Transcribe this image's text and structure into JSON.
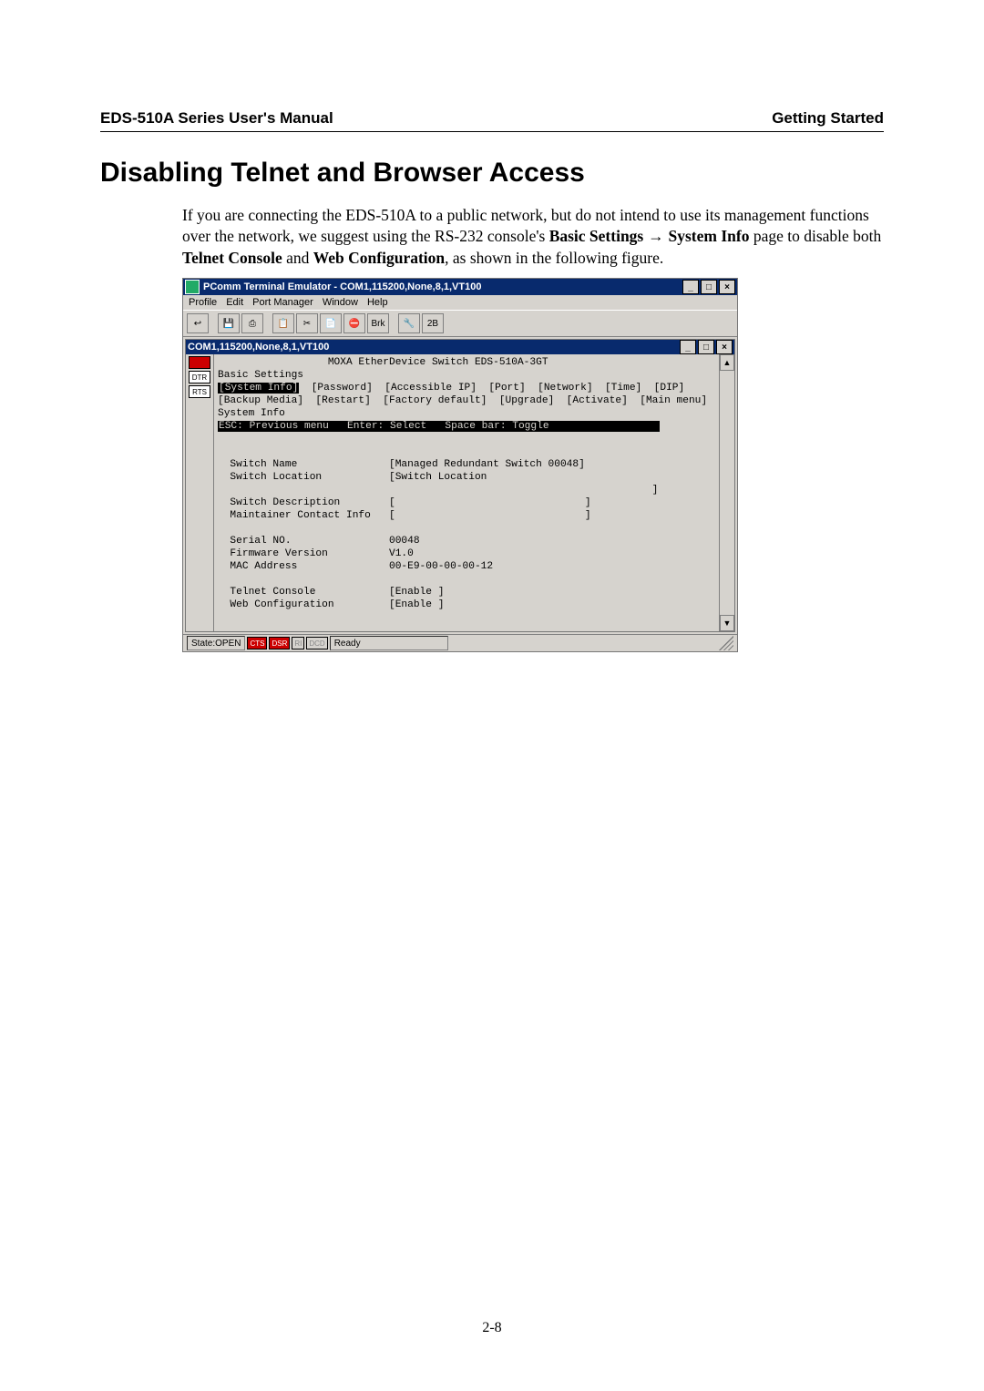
{
  "header": {
    "left": "EDS-510A Series User's Manual",
    "right": "Getting Started"
  },
  "heading": "Disabling Telnet and Browser Access",
  "paragraph": {
    "t1": "If you are connecting the EDS-510A to a public network, but do not intend to use its management functions over the network, we suggest using the RS-232 console's ",
    "b1": "Basic Settings",
    "arrow": " → ",
    "b2": "System Info",
    "t2": " page to disable both ",
    "b3": "Telnet Console",
    "t3": " and ",
    "b4": "Web Configuration",
    "t4": ", as shown in the following figure."
  },
  "screenshot": {
    "outer_title": "PComm Terminal Emulator - COM1,115200,None,8,1,VT100",
    "menus": [
      "Profile",
      "Edit",
      "Port Manager",
      "Window",
      "Help"
    ],
    "menu_underline_idx": [
      0,
      0,
      0,
      0,
      0
    ],
    "toolbar_labels": [
      "↩",
      "💾",
      "⎙",
      "📋",
      "✂",
      "📄",
      "⛔",
      "Brk",
      "",
      "🔧",
      "2B"
    ],
    "inner_title": "COM1,115200,None,8,1,VT100",
    "leds": [
      "",
      "DTR",
      "RTS"
    ],
    "terminal": {
      "device_title": "MOXA EtherDevice Switch EDS-510A-3GT",
      "section": "Basic Settings",
      "menu_row1_sel": "[System Info]",
      "menu_row1_rest": "  [Password]  [Accessible IP]  [Port]  [Network]  [Time]  [DIP]",
      "menu_row2": "[Backup Media]  [Restart]  [Factory default]  [Upgrade]  [Activate]  [Main menu]",
      "subtitle": "System Info",
      "navhint": "ESC: Previous menu   Enter: Select   Space bar: Toggle",
      "fields": [
        {
          "label": "Switch Name",
          "value": "[Managed Redundant Switch 00048]"
        },
        {
          "label": "Switch Location",
          "value": "[Switch Location"
        },
        {
          "label": "",
          "value": "                                           ]"
        },
        {
          "label": "Switch Description",
          "value": "[                               ]"
        },
        {
          "label": "Maintainer Contact Info",
          "value": "[                               ]"
        },
        {
          "label": "",
          "value": ""
        },
        {
          "label": "Serial NO.",
          "value": "00048"
        },
        {
          "label": "Firmware Version",
          "value": "V1.0"
        },
        {
          "label": "MAC Address",
          "value": "00-E9-00-00-00-12"
        },
        {
          "label": "",
          "value": ""
        },
        {
          "label": "Telnet Console",
          "value": "[Enable ]"
        },
        {
          "label": "Web Configuration",
          "value": "[Enable ]"
        }
      ]
    },
    "status": {
      "state": "State:OPEN",
      "leds": [
        "CTS",
        "DSR",
        "RI",
        "DCD"
      ],
      "led_on": [
        true,
        true,
        false,
        false
      ],
      "ready": "Ready"
    },
    "winbtns": {
      "min": "_",
      "max": "□",
      "close": "×"
    }
  },
  "page_number": "2-8"
}
